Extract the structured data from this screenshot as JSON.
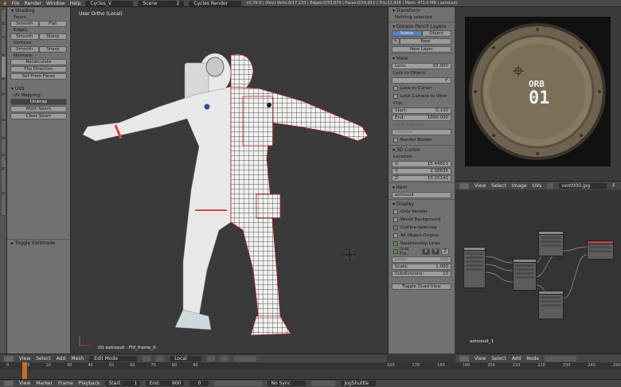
{
  "topbar": {
    "menus": [
      "File",
      "Render",
      "Window",
      "Help"
    ],
    "layout": "Cycles_V",
    "scene": "Scene",
    "scene_num": "2",
    "engine": "Cycles Render",
    "stats": "v2.79.6 | (Key) Verts:0/17,133 | Edges:0/33,870 | Faces:0/16,811 | Tris:32,928 | Mem: 473.0 MB | astrosuit"
  },
  "left_tabs": [
    "Tools",
    "Create",
    "Relations",
    "Shading / UVs",
    "Options",
    "Grease Pencil",
    "3D-Print",
    "Display",
    "Misc",
    "Retopology",
    "Animation"
  ],
  "toolshelf": {
    "shading_header": "Shading",
    "faces_label": "Faces:",
    "smooth": "Smooth",
    "flat": "Flat",
    "edges_label": "Edges:",
    "edges_smooth": "Smooth",
    "edges_sharp": "Sharp",
    "vertices_label": "Vertices:",
    "vert_smooth": "Smooth",
    "vert_sharp": "Sharp",
    "normals_label": "Normals:",
    "recalculate": "Recalculate",
    "flip_direction": "Flip Direction",
    "set_from_faces": "Set From Faces",
    "uvs_header": "UVs",
    "uv_mapping_label": "UV Mapping:",
    "unwrap": "Unwrap",
    "mark_seam": "Mark Seam",
    "clear_seam": "Clear Seam",
    "toggle_editmode": "Toggle Editmode"
  },
  "viewport": {
    "view_label": "User Ortho (Local)",
    "object_label": "(0) astrosuit : FIX_frame_0",
    "header": {
      "menus": [
        "View",
        "Select",
        "Add",
        "Mesh"
      ],
      "mode": "Edit Mode",
      "pivot": "Local"
    }
  },
  "props": {
    "transform_header": "Transform",
    "nothing_selected": "Nothing selected",
    "grease_pencil_header": "Grease Pencil Layers",
    "scene_btn": "Scene",
    "object_btn": "Object",
    "new_btn": "New",
    "new_layer": "New Layer",
    "view_header": "View",
    "lens_label": "Lens:",
    "lens_value": "93.000",
    "lock_to_object": "Lock to Object:",
    "lock_to_cursor": "Lock to Cursor",
    "lock_camera": "Lock Camera to View",
    "clip_label": "Clip:",
    "start_label": "Start:",
    "start_value": "0.100",
    "end_label": "End:",
    "end_value": "1000.000",
    "local_camera": "Local Camera:",
    "camera_field": "Camera",
    "render_border": "Render Border",
    "cursor_header": "3D Cursor",
    "location_label": "Location:",
    "x_label": "X:",
    "x_value": "15.44611",
    "y_label": "Y:",
    "y_value": "2.38635",
    "z_label": "Z:",
    "z_value": "10.20141",
    "item_header": "Item",
    "item_name": "astrosuit",
    "display_header": "Display",
    "only_render": "Only Render",
    "world_background": "World Background",
    "outline_selected": "Outline Selected",
    "all_object_origins": "All Object Origins",
    "relationship_lines": "Relationship Lines",
    "grid_floor": "Grid Flo...",
    "axis_x": "X",
    "axis_y": "Y",
    "axis_z": "Z",
    "lines_label": "Lines:",
    "lines_value": "100",
    "scale_label": "Scale:",
    "scale_value": "1.000",
    "subdivisions_label": "Subdivisions:",
    "subdivisions_value": "10",
    "toggle_quad_view": "Toggle Quad View"
  },
  "image_editor": {
    "plate_line1": "ORB",
    "plate_line2": "01",
    "menus": [
      "View",
      "Select",
      "Image",
      "UVs"
    ],
    "image_name": "vent000.jpg",
    "image_f": "F"
  },
  "node_editor": {
    "material_label": "astrosuit_1",
    "menus": [
      "View",
      "Select",
      "Add",
      "Node"
    ]
  },
  "timeline": {
    "ticks": [
      "0",
      "10",
      "20",
      "30",
      "40",
      "50",
      "60",
      "70",
      "80",
      "90",
      "160",
      "170",
      "180",
      "190",
      "200",
      "210",
      "220",
      "230",
      "240",
      "250"
    ],
    "menus": [
      "View",
      "Marker",
      "Frame",
      "Playback"
    ],
    "start_label": "Start:",
    "start_value": "1",
    "end_label": "End:",
    "end_value": "900",
    "current": "0",
    "sync": "No Sync",
    "keying": "JogShuttle"
  }
}
